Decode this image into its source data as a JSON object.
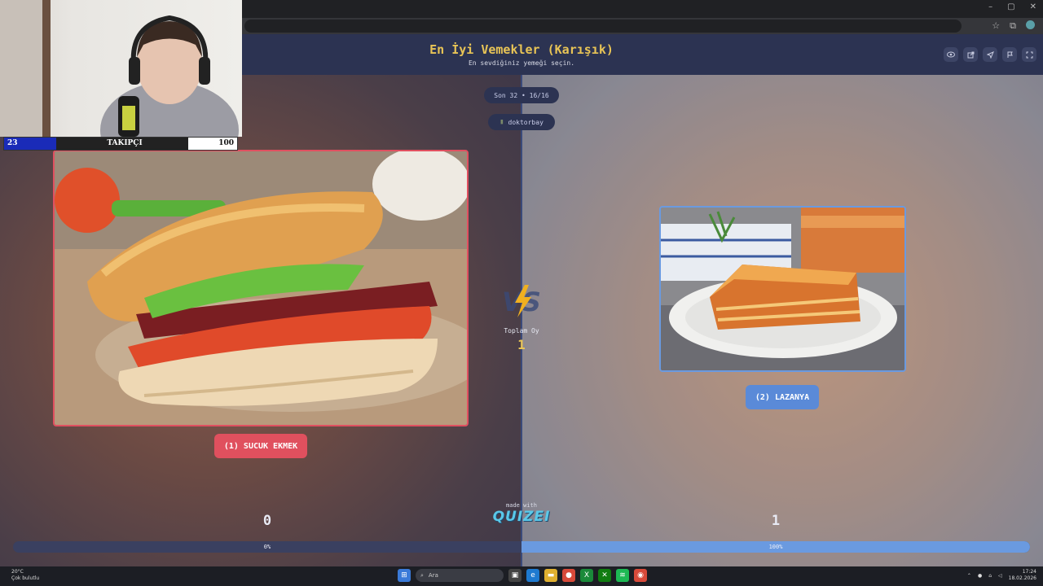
{
  "browser": {
    "window_controls": [
      "–",
      "▢",
      "✕"
    ],
    "address_icons": [
      "☆",
      "⧉"
    ]
  },
  "header": {
    "title": "En İyi Vemekler (Karışık)",
    "subtitle": "En sevdiğiniz yemeği seçin.",
    "icons": [
      "eye-icon",
      "share-icon",
      "send-icon",
      "flag-icon",
      "fullscreen-icon"
    ]
  },
  "round_info": "Son 32 • 16/16",
  "username": "doktorbay",
  "left": {
    "button_label": "(1) SUCUK EKMEK",
    "votes": "0",
    "percent": "0%",
    "percent_value": 0
  },
  "right": {
    "button_label": "(2) LAZANYA",
    "votes": "1",
    "percent": "100%",
    "percent_value": 100
  },
  "vs_label": "VS",
  "total": {
    "label": "Toplam Oy",
    "value": "1"
  },
  "footer": {
    "made_with": "made with",
    "brand": "QUIZEI"
  },
  "webcam": {
    "left_count": "23",
    "label": "TAKIPÇI",
    "right_count": "100"
  },
  "taskbar": {
    "weather_temp": "20°C",
    "weather_desc": "Çok bulutlu",
    "search_placeholder": "Ara",
    "time": "17:24",
    "date": "18.02.2026"
  },
  "colors": {
    "accent_left": "#e0505e",
    "accent_right": "#5a8ad8",
    "title": "#e8c456"
  }
}
